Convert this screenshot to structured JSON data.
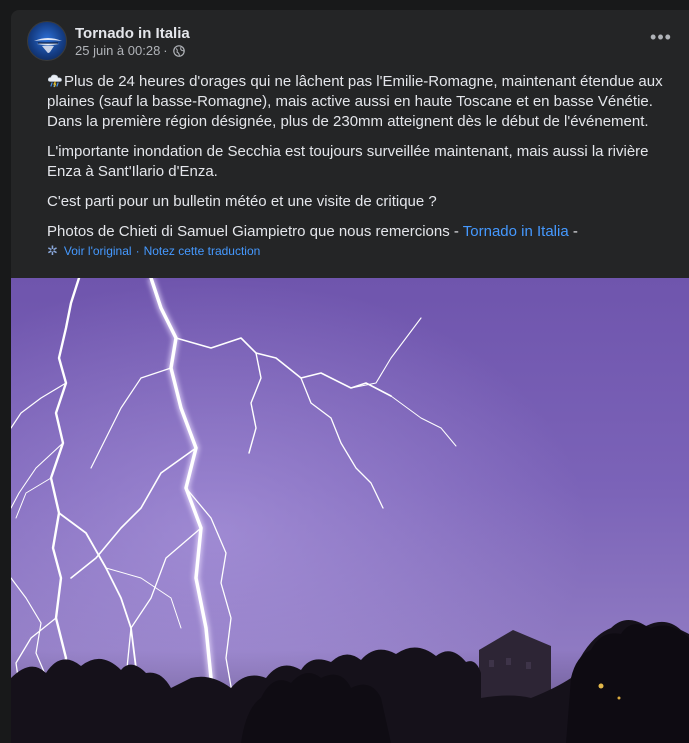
{
  "post": {
    "page_name": "Tornado in Italia",
    "timestamp": "25 juin à 00:28",
    "separator": "·",
    "more_icon_label": "•••",
    "paragraphs": {
      "p1": "Plus de 24 heures d'orages qui ne lâchent pas l'Emilie-Romagne, maintenant étendue aux plaines (sauf la basse-Romagne), mais active aussi en haute Toscane et en basse Vénétie. Dans la première région désignée, plus de 230mm atteignent dès le début de l'événement.",
      "p2": "L'importante inondation de Secchia est toujours surveillée maintenant, mais aussi la rivière Enza à Sant'Ilario d'Enza.",
      "p3": "C'est parti pour un bulletin météo et une visite de critique ?",
      "p4_text": "Photos de Chieti di Samuel Giampietro que nous remercions - ",
      "p4_link": "Tornado in Italia",
      "p4_end": " -"
    },
    "translation": {
      "see_original": "Voir l'original",
      "dot": "·",
      "rate": "Notez cette traduction"
    },
    "icons": {
      "emoji": "storm-cloud-icon",
      "privacy": "globe-icon",
      "translate": "gear-icon"
    },
    "colors": {
      "background": "#18191a",
      "card": "#242526",
      "link": "#4599ff",
      "sky": "#7a5fb8"
    }
  }
}
